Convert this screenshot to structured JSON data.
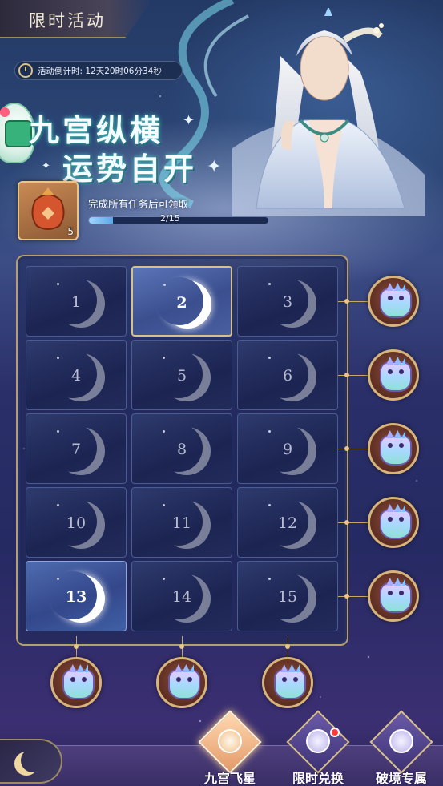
{
  "header": {
    "title": "限时活动"
  },
  "countdown": {
    "text": "活动倒计时: 12天20时06分34秒"
  },
  "banner": {
    "line1": "九宫纵横",
    "line2": "运势自开"
  },
  "reward": {
    "count": "5",
    "description": "完成所有任务后可领取",
    "progress_text": "2/15",
    "progress_fraction": 0.1333
  },
  "grid": {
    "cells": [
      {
        "label": "1",
        "state": "normal"
      },
      {
        "label": "2",
        "state": "active"
      },
      {
        "label": "3",
        "state": "normal"
      },
      {
        "label": "4",
        "state": "normal"
      },
      {
        "label": "5",
        "state": "normal"
      },
      {
        "label": "6",
        "state": "normal"
      },
      {
        "label": "7",
        "state": "normal"
      },
      {
        "label": "8",
        "state": "normal"
      },
      {
        "label": "9",
        "state": "normal"
      },
      {
        "label": "10",
        "state": "normal"
      },
      {
        "label": "11",
        "state": "normal"
      },
      {
        "label": "12",
        "state": "normal"
      },
      {
        "label": "13",
        "state": "active-b"
      },
      {
        "label": "14",
        "state": "normal"
      },
      {
        "label": "15",
        "state": "normal"
      }
    ]
  },
  "row_rewards": {
    "count": 5,
    "icon": "beast-icon"
  },
  "column_rewards": {
    "count": 3,
    "icon": "beast-icon"
  },
  "nav": {
    "items": [
      {
        "label": "九宫飞星",
        "selected": true,
        "icon": "star-icon"
      },
      {
        "label": "限时兑换",
        "selected": false,
        "icon": "exchange-icon",
        "badge": true
      },
      {
        "label": "破境专属",
        "selected": false,
        "icon": "figure-icon"
      }
    ]
  },
  "colors": {
    "accent_gold": "#d7c08a",
    "background": "#262a63",
    "badge_red": "#ff3b3b"
  }
}
